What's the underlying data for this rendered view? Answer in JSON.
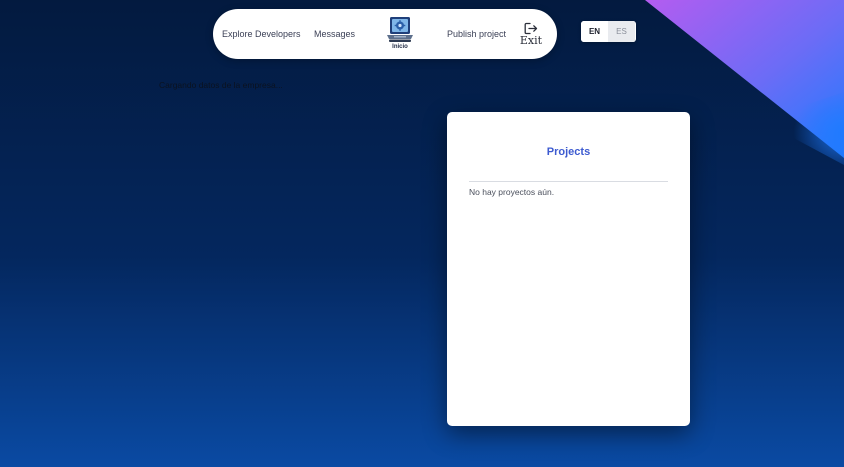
{
  "nav": {
    "explore_label": "Explore Developers",
    "messages_label": "Messages",
    "logo_label": "Inicio",
    "publish_label": "Publish project",
    "exit_label": "Exit"
  },
  "lang": {
    "en_label": "EN",
    "es_label": "ES",
    "active": "EN"
  },
  "status": {
    "loading_text": "Cargando datos de la empresa..."
  },
  "projects_card": {
    "title": "Projects",
    "empty_text": "No hay proyectos aún."
  },
  "colors": {
    "accent": "#3d5bd0",
    "background_top": "#031a3f",
    "background_bottom": "#0a4aa3",
    "corner_purple": "#b45cf0",
    "corner_blue": "#1e7bff"
  },
  "icons": {
    "logo": "laptop-logo-icon",
    "exit": "logout-icon"
  }
}
